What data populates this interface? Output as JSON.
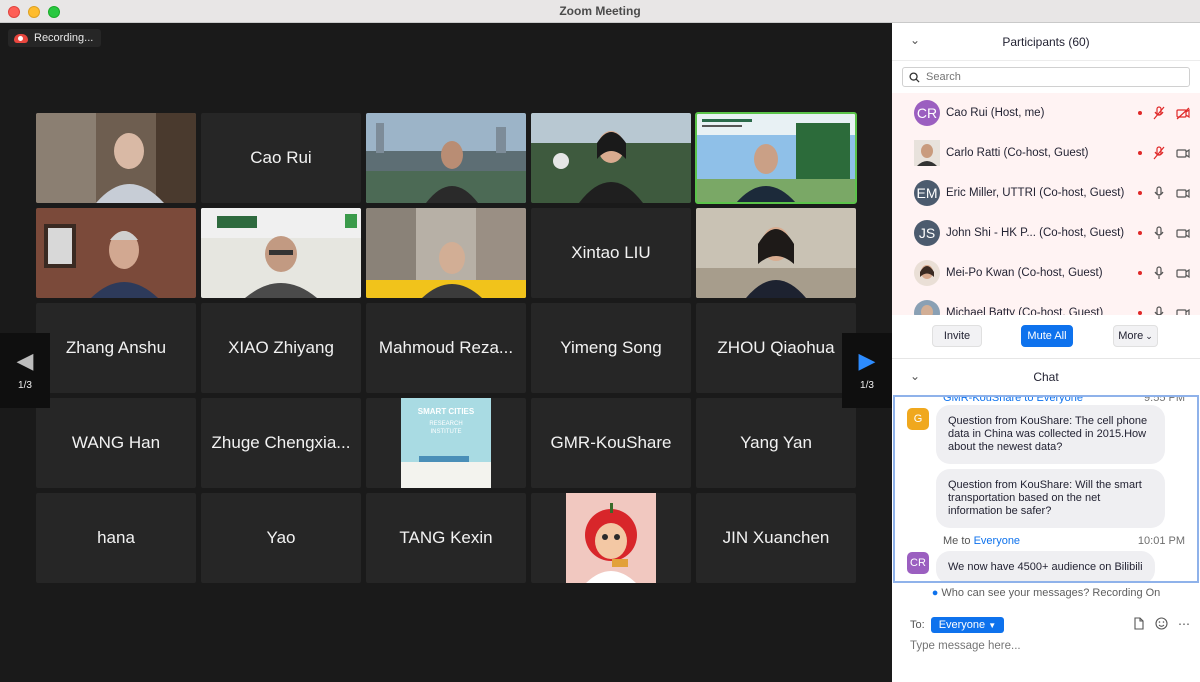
{
  "window": {
    "title": "Zoom Meeting"
  },
  "recording": {
    "label": "Recording..."
  },
  "tiles": [
    {
      "name": "",
      "kind": "video",
      "desc": "man-in-office"
    },
    {
      "name": "Cao Rui",
      "kind": "name"
    },
    {
      "name": "",
      "kind": "video"
    },
    {
      "name": "",
      "kind": "video"
    },
    {
      "name": "",
      "kind": "video",
      "active": true
    },
    {
      "name": "",
      "kind": "video"
    },
    {
      "name": "",
      "kind": "video"
    },
    {
      "name": "",
      "kind": "video"
    },
    {
      "name": "Xintao LIU",
      "kind": "name"
    },
    {
      "name": "",
      "kind": "video"
    },
    {
      "name": "Zhang Anshu",
      "kind": "name"
    },
    {
      "name": "XIAO Zhiyang",
      "kind": "name"
    },
    {
      "name": "Mahmoud Reza...",
      "kind": "name"
    },
    {
      "name": "Yimeng Song",
      "kind": "name"
    },
    {
      "name": "ZHOU Qiaohua",
      "kind": "name"
    },
    {
      "name": "WANG Han",
      "kind": "name"
    },
    {
      "name": "Zhuge Chengxia...",
      "kind": "name"
    },
    {
      "name": "",
      "kind": "image",
      "image_text": [
        "SMART CITIES",
        "RESEARCH",
        "INSTITUTE"
      ]
    },
    {
      "name": "GMR-KouShare",
      "kind": "name"
    },
    {
      "name": "Yang Yan",
      "kind": "name"
    },
    {
      "name": "hana",
      "kind": "name"
    },
    {
      "name": "Yao",
      "kind": "name"
    },
    {
      "name": "TANG Kexin",
      "kind": "name"
    },
    {
      "name": "",
      "kind": "avatar-image"
    },
    {
      "name": "JIN Xuanchen",
      "kind": "name"
    }
  ],
  "pager": {
    "left": "1/3",
    "right": "1/3"
  },
  "participants": {
    "title": "Participants (60)",
    "search_placeholder": "Search",
    "list": [
      {
        "initials": "CR",
        "color": "#9b5fc0",
        "name": "Cao Rui (Host, me)",
        "mic": "muted",
        "video": "off"
      },
      {
        "initials": "",
        "color": "#7a6150",
        "name": "Carlo Ratti (Co-host, Guest)",
        "mic": "muted",
        "video": "on"
      },
      {
        "initials": "EM",
        "color": "#4c5b6e",
        "name": "Eric Miller, UTTRI (Co-host, Guest)",
        "mic": "on",
        "video": "on"
      },
      {
        "initials": "JS",
        "color": "#4c5b6e",
        "name": "John Shi - HK P...   (Co-host, Guest)",
        "mic": "on",
        "video": "on"
      },
      {
        "initials": "",
        "color": "#b08a78",
        "name": "Mei-Po Kwan (Co-host, Guest)",
        "mic": "on",
        "video": "on"
      },
      {
        "initials": "",
        "color": "#6a7a8a",
        "name": "Michael Batty (Co-host, Guest)",
        "mic": "on",
        "video": "on"
      }
    ],
    "actions": {
      "invite": "Invite",
      "mute_all": "Mute All",
      "more": "More"
    }
  },
  "chat": {
    "title": "Chat",
    "messages": [
      {
        "sender": "GMR-KouShare to Everyone",
        "time": "9:55 PM",
        "avatar": "G",
        "avatar_color": "#f0a81e",
        "bubbles": [
          "Question from KouShare: The cell phone data in China was collected in 2015.How about the newest data?",
          "Question from KouShare: Will the smart transportation based on the net information be safer?"
        ]
      },
      {
        "sender_me": "Me to",
        "sender_target": "Everyone",
        "time": "10:01 PM",
        "avatar": "CR",
        "avatar_color": "#9b5fc0",
        "bubbles": [
          "We now have 4500+ audience on Bilibili"
        ]
      }
    ],
    "visibility": "Who can see your messages? Recording On",
    "to_label": "To:",
    "to_value": "Everyone",
    "input_placeholder": "Type message here..."
  }
}
